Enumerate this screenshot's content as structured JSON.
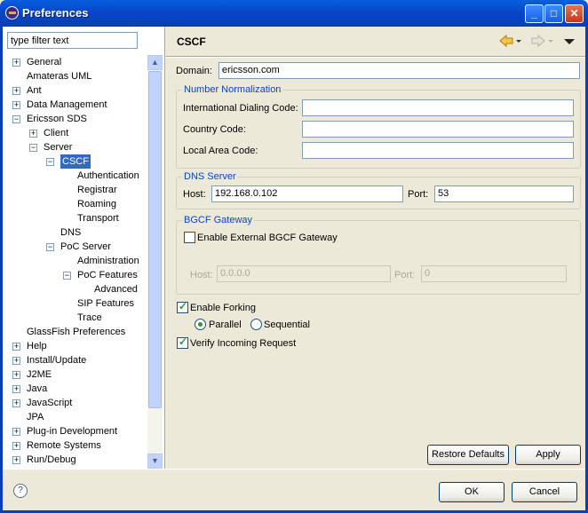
{
  "window": {
    "title": "Preferences"
  },
  "colors": {
    "titlebar": "#0a46c8",
    "selection": "#316ac5",
    "group_title": "#0046d5"
  },
  "filter": {
    "placeholder": "type filter text"
  },
  "tree": {
    "items": [
      {
        "label": "General",
        "expander": "+"
      },
      {
        "label": "Amateras UML",
        "expander": ""
      },
      {
        "label": "Ant",
        "expander": "+"
      },
      {
        "label": "Data Management",
        "expander": "+"
      },
      {
        "label": "Ericsson SDS",
        "expander": "-"
      },
      {
        "label": "Client",
        "expander": "+"
      },
      {
        "label": "Server",
        "expander": "-"
      },
      {
        "label": "CSCF",
        "expander": "-",
        "selected": true
      },
      {
        "label": "Authentication",
        "expander": ""
      },
      {
        "label": "Registrar",
        "expander": ""
      },
      {
        "label": "Roaming",
        "expander": ""
      },
      {
        "label": "Transport",
        "expander": ""
      },
      {
        "label": "DNS",
        "expander": ""
      },
      {
        "label": "PoC Server",
        "expander": "-"
      },
      {
        "label": "Administration",
        "expander": ""
      },
      {
        "label": "PoC Features",
        "expander": "-"
      },
      {
        "label": "Advanced",
        "expander": ""
      },
      {
        "label": "SIP Features",
        "expander": ""
      },
      {
        "label": "Trace",
        "expander": ""
      },
      {
        "label": "GlassFish Preferences",
        "expander": ""
      },
      {
        "label": "Help",
        "expander": "+"
      },
      {
        "label": "Install/Update",
        "expander": "+"
      },
      {
        "label": "J2ME",
        "expander": "+"
      },
      {
        "label": "Java",
        "expander": "+"
      },
      {
        "label": "JavaScript",
        "expander": "+"
      },
      {
        "label": "JPA",
        "expander": ""
      },
      {
        "label": "Plug-in Development",
        "expander": "+"
      },
      {
        "label": "Remote Systems",
        "expander": "+"
      },
      {
        "label": "Run/Debug",
        "expander": "+"
      }
    ]
  },
  "page": {
    "title": "CSCF",
    "domain_label": "Domain:",
    "domain_value": "ericsson.com",
    "number_normalization": {
      "title": "Number Normalization",
      "intl_label": "International Dialing Code:",
      "intl_value": "",
      "country_label": "Country Code:",
      "country_value": "",
      "area_label": "Local Area Code:",
      "area_value": ""
    },
    "dns_server": {
      "title": "DNS Server",
      "host_label": "Host:",
      "host_value": "192.168.0.102",
      "port_label": "Port:",
      "port_value": "53"
    },
    "bgcf": {
      "title": "BGCF Gateway",
      "enable_label": "Enable External BGCF Gateway",
      "enabled": false,
      "host_label": "Host:",
      "host_value": "0.0.0.0",
      "port_label": "Port:",
      "port_value": "0"
    },
    "forking": {
      "enable_label": "Enable Forking",
      "enabled": true,
      "parallel_label": "Parallel",
      "sequential_label": "Sequential",
      "selected": "Parallel"
    },
    "verify_label": "Verify Incoming Request",
    "verify_enabled": true,
    "restore_label": "Restore Defaults",
    "apply_label": "Apply"
  },
  "dialog": {
    "ok_label": "OK",
    "cancel_label": "Cancel",
    "help_icon": "?"
  }
}
